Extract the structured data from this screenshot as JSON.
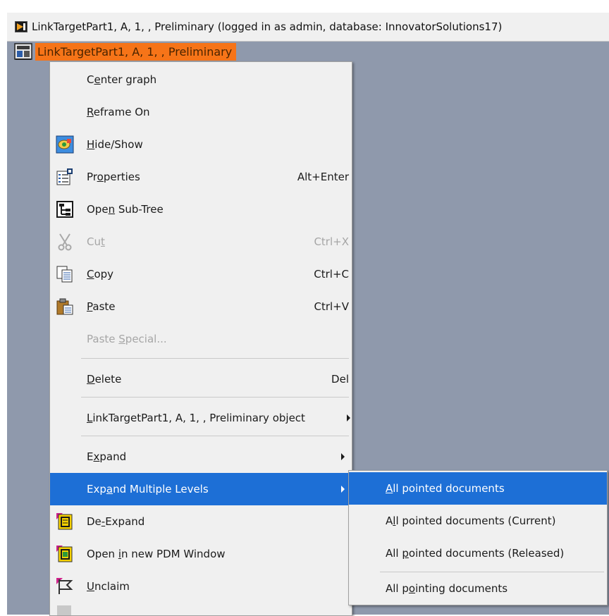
{
  "window": {
    "title": "LinkTargetPart1, A, 1, , Preliminary (logged in as admin, database: InnovatorSolutions17)",
    "tree_node": "LinkTargetPart1, A, 1, , Preliminary"
  },
  "context_menu": {
    "items": [
      {
        "label_parts": [
          "C",
          "e",
          "nter graph"
        ],
        "shortcut": ""
      },
      {
        "label_parts": [
          "",
          "R",
          "eframe On"
        ],
        "shortcut": ""
      },
      {
        "label_parts": [
          "",
          "H",
          "ide/Show"
        ],
        "shortcut": "",
        "icon": "hide-show-icon"
      },
      {
        "label_parts": [
          "Pr",
          "o",
          "perties"
        ],
        "shortcut": "Alt+Enter",
        "icon": "properties-icon"
      },
      {
        "label_parts": [
          "Ope",
          "n",
          " Sub-Tree"
        ],
        "shortcut": "",
        "icon": "tree-icon"
      },
      {
        "label_parts": [
          "Cu",
          "t",
          ""
        ],
        "shortcut": "Ctrl+X",
        "icon": "scissors-icon",
        "disabled": true
      },
      {
        "label_parts": [
          "",
          "C",
          "opy"
        ],
        "shortcut": "Ctrl+C",
        "icon": "copy-icon"
      },
      {
        "label_parts": [
          "",
          "P",
          "aste"
        ],
        "shortcut": "Ctrl+V",
        "icon": "paste-icon"
      },
      {
        "label_parts": [
          "Paste ",
          "S",
          "pecial..."
        ],
        "shortcut": "",
        "disabled": true
      },
      {
        "label_parts": [
          "",
          "D",
          "elete"
        ],
        "shortcut": "Del"
      },
      {
        "label_parts": [
          "",
          "L",
          "inkTargetPart1, A, 1, , Preliminary object"
        ],
        "shortcut": "",
        "submenu": true
      },
      {
        "label_parts": [
          "E",
          "x",
          "pand"
        ],
        "shortcut": "",
        "submenu": true
      },
      {
        "label_parts": [
          "Exp",
          "a",
          "nd Multiple Levels"
        ],
        "shortcut": "",
        "submenu": true,
        "highlighted": true
      },
      {
        "label_parts": [
          "De",
          "-",
          "Expand"
        ],
        "shortcut": "",
        "icon": "de-expand-icon"
      },
      {
        "label_parts": [
          "Open ",
          "i",
          "n new PDM Window"
        ],
        "shortcut": "",
        "icon": "pdm-window-icon"
      },
      {
        "label_parts": [
          "",
          "U",
          "nclaim"
        ],
        "shortcut": "",
        "icon": "flag-icon"
      }
    ]
  },
  "expand_submenu": {
    "items": [
      {
        "label_parts": [
          "",
          "A",
          "ll pointed documents"
        ]
      },
      {
        "label_parts": [
          "A",
          "l",
          "l pointed documents (Current)"
        ]
      },
      {
        "label_parts": [
          "All ",
          "p",
          "ointed documents (Released)"
        ]
      },
      {
        "label_parts": [
          "All p",
          "o",
          "inting documents"
        ]
      }
    ]
  },
  "colors": {
    "highlight": "#1d6fd6",
    "tree_label_bg": "#f67418",
    "canvas": "#8f99ac"
  }
}
